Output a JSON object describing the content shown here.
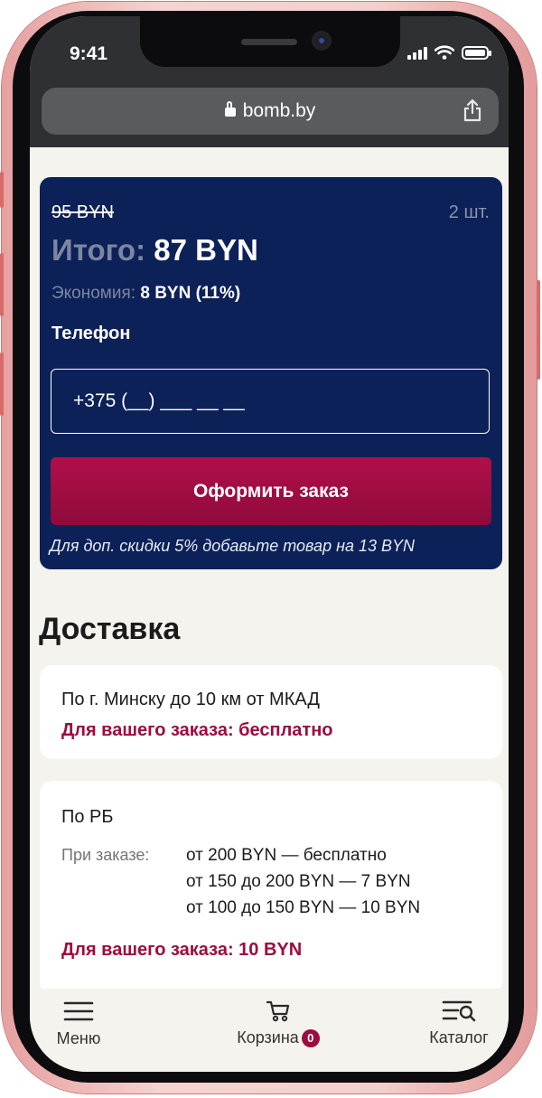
{
  "status_bar": {
    "time": "9:41"
  },
  "browser": {
    "url": "bomb.by"
  },
  "order_summary": {
    "old_price": "95 BYN",
    "quantity": "2 шт.",
    "total_label": "Итого:",
    "total_value": "87 BYN",
    "savings_label": "Экономия:",
    "savings_value": "8 BYN (11%)",
    "phone_label": "Телефон",
    "phone_placeholder": "+375 (__) ___ __ __",
    "submit_label": "Оформить заказ",
    "hint": "Для доп. скидки 5% добавьте товар на 13 BYN"
  },
  "delivery": {
    "title": "Доставка",
    "options": [
      {
        "title": "По г. Минску до 10 км от МКАД",
        "note": "Для вашего заказа: бесплатно"
      },
      {
        "title": "По РБ",
        "rates_label": "При заказе:",
        "rates": [
          "от 200 BYN — бесплатно",
          "от 150 до 200 BYN — 7 BYN",
          "от 100 до 150 BYN — 10 BYN"
        ],
        "note": "Для вашего заказа: 10 BYN"
      }
    ]
  },
  "tabbar": {
    "menu": "Меню",
    "cart": "Корзина",
    "cart_count": "0",
    "catalog": "Каталог"
  },
  "colors": {
    "accent": "#9d0b3f",
    "card_bg": "#0c2158",
    "page_bg": "#f4f3ee"
  }
}
